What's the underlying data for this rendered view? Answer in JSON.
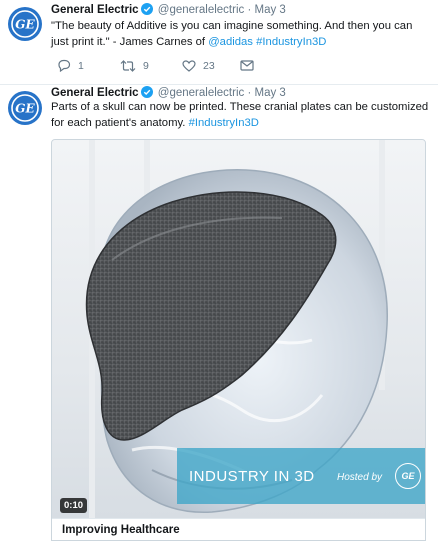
{
  "colors": {
    "brand": "#2773c8",
    "link": "#1b95e0",
    "muted": "#657786",
    "banner": "#3ea5c8"
  },
  "tweets": [
    {
      "author": "General Electric",
      "handle": "@generalelectric",
      "separator": "·",
      "date": "May 3",
      "verified": true,
      "avatar_icon": "ge-logo-icon",
      "text": {
        "part1": "\"The beauty of Additive is you can imagine something. And then you can just print it.\" - James Carnes of ",
        "mention": "@adidas",
        "space": " ",
        "hashtag": "#IndustryIn3D"
      },
      "actions": {
        "replies": "1",
        "retweets": "9",
        "likes": "23"
      }
    },
    {
      "author": "General Electric",
      "handle": "@generalelectric",
      "separator": "·",
      "date": "May 3",
      "verified": true,
      "avatar_icon": "ge-logo-icon",
      "text": {
        "part1": "Parts of a skull can now be printed. These cranial plates can be customized for each patient's anatomy. ",
        "hashtag": "#IndustryIn3D"
      },
      "media": {
        "duration": "0:10",
        "banner_title": "INDUSTRY IN 3D",
        "banner_hosted": "Hosted by",
        "banner_logo": "GE",
        "card_title": "Improving Healthcare"
      }
    }
  ]
}
